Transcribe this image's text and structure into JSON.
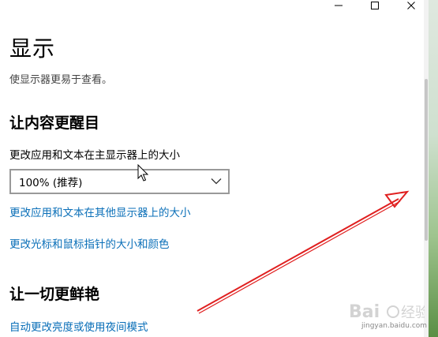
{
  "window": {
    "controls": {
      "minimize_icon": "minimize-icon",
      "maximize_icon": "maximize-icon",
      "close_icon": "close-icon"
    }
  },
  "page": {
    "title": "显示",
    "description": "使显示器更易于查看。"
  },
  "section_readability": {
    "title": "让内容更醒目",
    "scale_label": "更改应用和文本在主显示器上的大小",
    "scale_dropdown": {
      "selected": "100% (推荐)",
      "icon": "chevron-down-icon"
    },
    "links": [
      "更改应用和文本在其他显示器上的大小",
      "更改光标和鼠标指针的大小和颜色"
    ]
  },
  "section_vivid": {
    "title": "让一切更鲜艳",
    "links": [
      "自动更改亮度或使用夜间模式"
    ]
  },
  "watermark": {
    "text": "Baidu 经验",
    "url_text": "jingyan.baidu.com"
  },
  "colors": {
    "link": "#0a6fb8",
    "annotation_arrow": "#e02020"
  }
}
